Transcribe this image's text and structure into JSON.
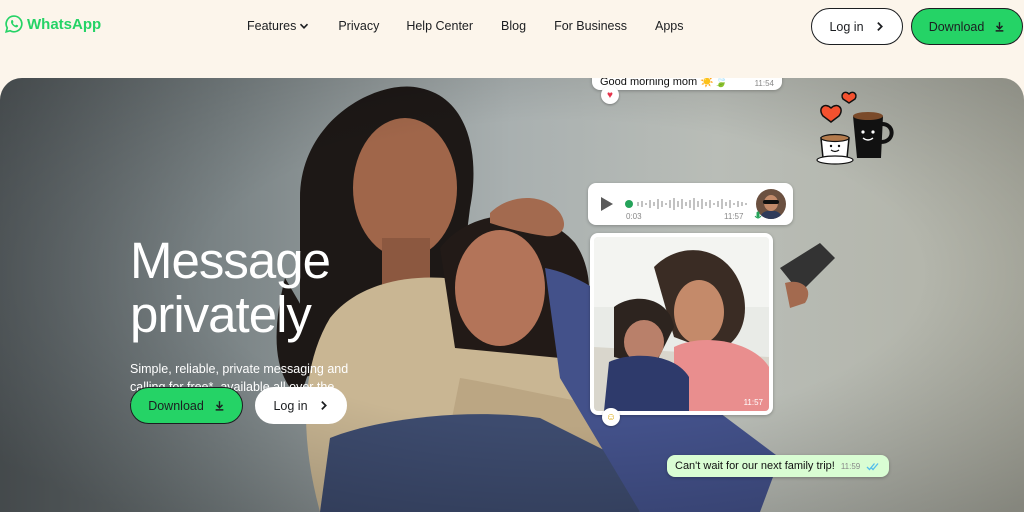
{
  "brand": {
    "name": "WhatsApp",
    "color": "#25d366"
  },
  "nav": {
    "links": [
      {
        "label": "Features",
        "has_dropdown": true
      },
      {
        "label": "Privacy"
      },
      {
        "label": "Help Center"
      },
      {
        "label": "Blog"
      },
      {
        "label": "For Business"
      },
      {
        "label": "Apps"
      }
    ],
    "login_label": "Log in",
    "download_label": "Download"
  },
  "hero": {
    "title": "Message\nprivately",
    "subtitle": "Simple, reliable, private messaging and calling for free*, available all over the world.",
    "download_label": "Download",
    "login_label": "Log in"
  },
  "chat": {
    "top_message": {
      "text": "Good morning mom ☀️🍃",
      "time": "11:54",
      "reaction": "heart"
    },
    "voice_note": {
      "elapsed": "0:03",
      "time": "11:57"
    },
    "photo": {
      "time": "11:57",
      "reaction": "laughing-emoji"
    },
    "outgoing": {
      "text": "Can't wait for our next family trip!",
      "time": "11:59",
      "status": "read"
    }
  },
  "icons": {
    "logo": "whatsapp-logo-icon",
    "dropdown": "chevron-down-icon",
    "arrow": "chevron-right-icon",
    "download": "download-icon",
    "play": "play-icon",
    "mic": "mic-icon",
    "read": "double-check-icon",
    "sticker": "coffee-cups-sticker"
  },
  "colors": {
    "accent": "#25d366",
    "background": "#fcf5eb",
    "outgoing_bubble": "#d9fdd3",
    "read_ticks": "#53bdeb"
  }
}
